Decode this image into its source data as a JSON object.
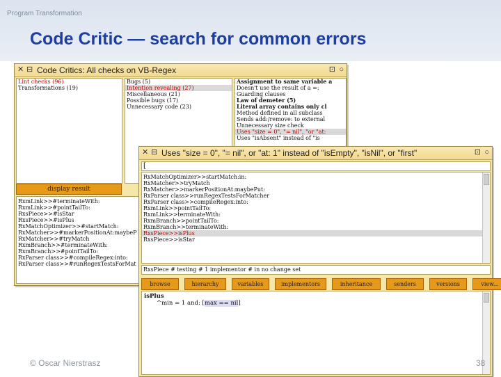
{
  "slide": {
    "running_title": "Program Transformation",
    "title": "Code Critic — search for common errors",
    "footer": "© Oscar Nierstrasz",
    "page_number": "38"
  },
  "critic_window": {
    "title": "Code Critics: All checks on VB-Regex",
    "categories": [
      {
        "label": "Lint checks (96)",
        "red": true
      },
      {
        "label": "Transformations (19)",
        "red": false
      }
    ],
    "checks": [
      {
        "label": "Bugs (5)",
        "red": false,
        "selected": false
      },
      {
        "label": "Intention revealing (27)",
        "red": true,
        "selected": true
      },
      {
        "label": "Miscellaneous (21)",
        "red": false,
        "selected": false
      },
      {
        "label": "Possible bugs (17)",
        "red": false,
        "selected": false
      },
      {
        "label": "Unnecessary code (23)",
        "red": false,
        "selected": false
      }
    ],
    "rules": [
      {
        "label": "Assignment to same variable a",
        "red": false,
        "bold": true
      },
      {
        "label": "Doesn't use the result of a =:",
        "red": false,
        "bold": false
      },
      {
        "label": "Guarding clauses",
        "red": false,
        "bold": false
      },
      {
        "label": "Law of demeter (5)",
        "red": false,
        "bold": true
      },
      {
        "label": "Literal array contains only cl",
        "red": false,
        "bold": true
      },
      {
        "label": "Method defined in all subclass",
        "red": false,
        "bold": false
      },
      {
        "label": "Sends add:/remove: to external",
        "red": false,
        "bold": false
      },
      {
        "label": "Unnecessary size check",
        "red": false,
        "bold": false
      },
      {
        "label": "Uses \"size = 0\", \"= nil\", \"or \"at:",
        "red": true,
        "bold": false
      },
      {
        "label": "Uses \"isAbsent\" instead of \"is",
        "red": false,
        "bold": false
      }
    ],
    "display_result_button": "display result",
    "results": [
      "RxmLink>>#terminateWith:",
      "RxmLink>>#pointTailTo:",
      "RxsPiece>>#isStar",
      "RxsPiece>>#isPlus",
      "RxMatchOptimizer>>#startMatch:",
      "RxMatcher>>#markerPositionAt:maybeP",
      "RxMatcher>>#tryMatch",
      "RxmBranch>>#terminateWith:",
      "RxmBranch>>#pointTailTo:",
      "RxParser class>>#compileRegex:into:",
      "RxParser class>>#runRegexTestsForMat"
    ]
  },
  "browser_window": {
    "title": "Uses \"size = 0\", \"= nil\", or \"at: 1\" instead of \"isEmpty\", \"isNil\", or \"first\"",
    "filter_text": "[",
    "methods": [
      {
        "label": "RxMatchOptimizer>>startMatch:in:",
        "selected": false
      },
      {
        "label": "RxMatcher>>tryMatch",
        "selected": false
      },
      {
        "label": "RxMatcher>>markerPositionAt:maybePut:",
        "selected": false
      },
      {
        "label": "RxParser class>>runRegexTestsForMatcher",
        "selected": false
      },
      {
        "label": "RxParser class>>compileRegex:into:",
        "selected": false
      },
      {
        "label": "RxmLink>>pointTailTo:",
        "selected": false
      },
      {
        "label": "RxmLink>>terminateWith:",
        "selected": false
      },
      {
        "label": "  RxmBranch>>pointTailTo:",
        "selected": false
      },
      {
        "label": "  RxmBranch>>terminateWith:",
        "selected": false
      },
      {
        "label": "RxsPiece>>isPlus",
        "selected": true
      },
      {
        "label": "RxsPiece>>isStar",
        "selected": false
      }
    ],
    "annotation": "RxsPiece # testing # 1 implementor # in no change set",
    "toolbar": [
      "browse",
      "hierarchy",
      "variables",
      "implementors",
      "inheritance",
      "senders",
      "versions",
      "view..."
    ],
    "code_selector": "isPlus",
    "code_prefix": "^min = 1 and: [",
    "code_highlight": "max == nil",
    "code_suffix": "]"
  }
}
